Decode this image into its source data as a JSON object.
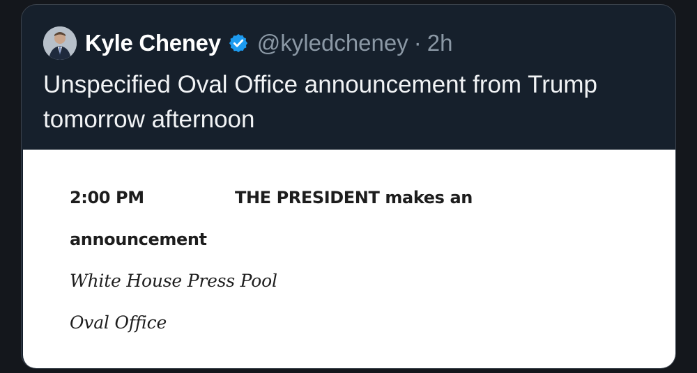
{
  "tweet": {
    "author_name": "Kyle Cheney",
    "handle": "@kyledcheney",
    "separator": "·",
    "time": "2h",
    "text": "Unspecified Oval Office announcement from Trump tomorrow afternoon",
    "verified_icon": "verified-badge-icon",
    "verified_color": "#1d9bf0"
  },
  "image": {
    "time": "2:00 PM",
    "event_line1": "THE PRESIDENT makes an",
    "event_line2": "announcement",
    "coverage": "White House Press Pool",
    "location": "Oval Office"
  }
}
